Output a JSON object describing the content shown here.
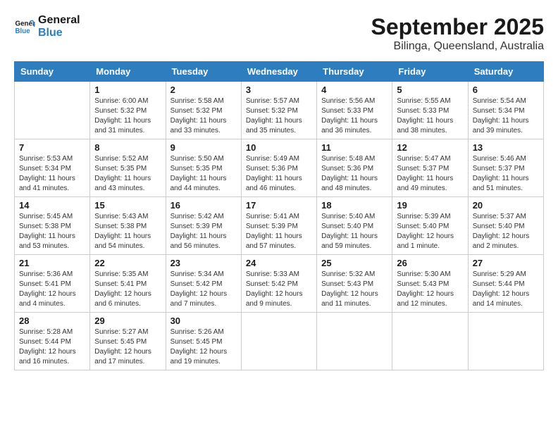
{
  "header": {
    "logo_line1": "General",
    "logo_line2": "Blue",
    "month": "September 2025",
    "location": "Bilinga, Queensland, Australia"
  },
  "weekdays": [
    "Sunday",
    "Monday",
    "Tuesday",
    "Wednesday",
    "Thursday",
    "Friday",
    "Saturday"
  ],
  "weeks": [
    [
      {
        "day": "",
        "info": ""
      },
      {
        "day": "1",
        "info": "Sunrise: 6:00 AM\nSunset: 5:32 PM\nDaylight: 11 hours\nand 31 minutes."
      },
      {
        "day": "2",
        "info": "Sunrise: 5:58 AM\nSunset: 5:32 PM\nDaylight: 11 hours\nand 33 minutes."
      },
      {
        "day": "3",
        "info": "Sunrise: 5:57 AM\nSunset: 5:32 PM\nDaylight: 11 hours\nand 35 minutes."
      },
      {
        "day": "4",
        "info": "Sunrise: 5:56 AM\nSunset: 5:33 PM\nDaylight: 11 hours\nand 36 minutes."
      },
      {
        "day": "5",
        "info": "Sunrise: 5:55 AM\nSunset: 5:33 PM\nDaylight: 11 hours\nand 38 minutes."
      },
      {
        "day": "6",
        "info": "Sunrise: 5:54 AM\nSunset: 5:34 PM\nDaylight: 11 hours\nand 39 minutes."
      }
    ],
    [
      {
        "day": "7",
        "info": "Sunrise: 5:53 AM\nSunset: 5:34 PM\nDaylight: 11 hours\nand 41 minutes."
      },
      {
        "day": "8",
        "info": "Sunrise: 5:52 AM\nSunset: 5:35 PM\nDaylight: 11 hours\nand 43 minutes."
      },
      {
        "day": "9",
        "info": "Sunrise: 5:50 AM\nSunset: 5:35 PM\nDaylight: 11 hours\nand 44 minutes."
      },
      {
        "day": "10",
        "info": "Sunrise: 5:49 AM\nSunset: 5:36 PM\nDaylight: 11 hours\nand 46 minutes."
      },
      {
        "day": "11",
        "info": "Sunrise: 5:48 AM\nSunset: 5:36 PM\nDaylight: 11 hours\nand 48 minutes."
      },
      {
        "day": "12",
        "info": "Sunrise: 5:47 AM\nSunset: 5:37 PM\nDaylight: 11 hours\nand 49 minutes."
      },
      {
        "day": "13",
        "info": "Sunrise: 5:46 AM\nSunset: 5:37 PM\nDaylight: 11 hours\nand 51 minutes."
      }
    ],
    [
      {
        "day": "14",
        "info": "Sunrise: 5:45 AM\nSunset: 5:38 PM\nDaylight: 11 hours\nand 53 minutes."
      },
      {
        "day": "15",
        "info": "Sunrise: 5:43 AM\nSunset: 5:38 PM\nDaylight: 11 hours\nand 54 minutes."
      },
      {
        "day": "16",
        "info": "Sunrise: 5:42 AM\nSunset: 5:39 PM\nDaylight: 11 hours\nand 56 minutes."
      },
      {
        "day": "17",
        "info": "Sunrise: 5:41 AM\nSunset: 5:39 PM\nDaylight: 11 hours\nand 57 minutes."
      },
      {
        "day": "18",
        "info": "Sunrise: 5:40 AM\nSunset: 5:40 PM\nDaylight: 11 hours\nand 59 minutes."
      },
      {
        "day": "19",
        "info": "Sunrise: 5:39 AM\nSunset: 5:40 PM\nDaylight: 12 hours\nand 1 minute."
      },
      {
        "day": "20",
        "info": "Sunrise: 5:37 AM\nSunset: 5:40 PM\nDaylight: 12 hours\nand 2 minutes."
      }
    ],
    [
      {
        "day": "21",
        "info": "Sunrise: 5:36 AM\nSunset: 5:41 PM\nDaylight: 12 hours\nand 4 minutes."
      },
      {
        "day": "22",
        "info": "Sunrise: 5:35 AM\nSunset: 5:41 PM\nDaylight: 12 hours\nand 6 minutes."
      },
      {
        "day": "23",
        "info": "Sunrise: 5:34 AM\nSunset: 5:42 PM\nDaylight: 12 hours\nand 7 minutes."
      },
      {
        "day": "24",
        "info": "Sunrise: 5:33 AM\nSunset: 5:42 PM\nDaylight: 12 hours\nand 9 minutes."
      },
      {
        "day": "25",
        "info": "Sunrise: 5:32 AM\nSunset: 5:43 PM\nDaylight: 12 hours\nand 11 minutes."
      },
      {
        "day": "26",
        "info": "Sunrise: 5:30 AM\nSunset: 5:43 PM\nDaylight: 12 hours\nand 12 minutes."
      },
      {
        "day": "27",
        "info": "Sunrise: 5:29 AM\nSunset: 5:44 PM\nDaylight: 12 hours\nand 14 minutes."
      }
    ],
    [
      {
        "day": "28",
        "info": "Sunrise: 5:28 AM\nSunset: 5:44 PM\nDaylight: 12 hours\nand 16 minutes."
      },
      {
        "day": "29",
        "info": "Sunrise: 5:27 AM\nSunset: 5:45 PM\nDaylight: 12 hours\nand 17 minutes."
      },
      {
        "day": "30",
        "info": "Sunrise: 5:26 AM\nSunset: 5:45 PM\nDaylight: 12 hours\nand 19 minutes."
      },
      {
        "day": "",
        "info": ""
      },
      {
        "day": "",
        "info": ""
      },
      {
        "day": "",
        "info": ""
      },
      {
        "day": "",
        "info": ""
      }
    ]
  ]
}
